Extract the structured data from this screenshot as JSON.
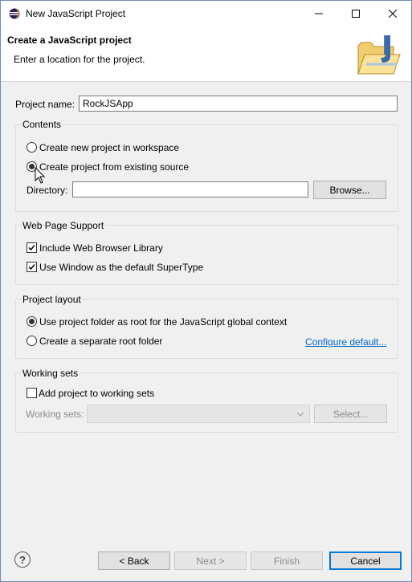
{
  "window": {
    "title": "New JavaScript Project",
    "controls": {
      "minimize": "minimize-icon",
      "maximize": "maximize-icon",
      "close": "close-icon"
    }
  },
  "header": {
    "title": "Create a JavaScript project",
    "message": "Enter a location for the project."
  },
  "project_name": {
    "label": "Project name:",
    "value": "RockJSApp"
  },
  "contents": {
    "title": "Contents",
    "option_new": "Create new project in workspace",
    "option_existing": "Create project from existing source",
    "selected": "option_existing",
    "directory_label": "Directory:",
    "directory_value": "",
    "browse_label": "Browse..."
  },
  "web_page_support": {
    "title": "Web Page Support",
    "include_browser_library": {
      "label": "Include Web Browser Library",
      "checked": true
    },
    "window_supertype": {
      "label": "Use Window as the default SuperType",
      "checked": true
    }
  },
  "project_layout": {
    "title": "Project layout",
    "option_root": "Use project folder as root for the JavaScript global context",
    "option_separate": "Create a separate root folder",
    "selected": "option_root",
    "configure_link": "Configure default..."
  },
  "working_sets": {
    "title": "Working sets",
    "add_label": "Add project to working sets",
    "add_checked": false,
    "sets_label": "Working sets:",
    "sets_value": "",
    "select_label": "Select..."
  },
  "footer": {
    "help_icon": "help-icon",
    "back_label": "< Back",
    "next_label": "Next >",
    "finish_label": "Finish",
    "cancel_label": "Cancel"
  },
  "colors": {
    "link": "#0066cc",
    "focus": "#0078d7",
    "dialog_bg": "#f0f0f0"
  }
}
